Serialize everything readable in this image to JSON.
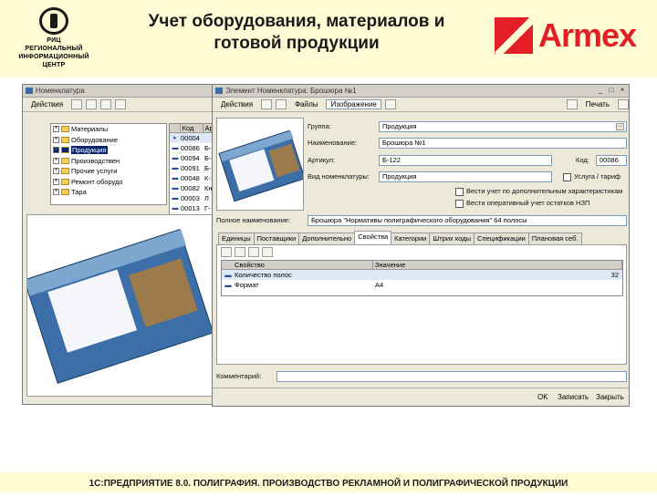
{
  "slide": {
    "logo_lines": [
      "РИЦ",
      "РЕГИОНАЛЬНЫЙ",
      "ИНФОРМАЦИОННЫЙ",
      "ЦЕНТР"
    ],
    "title_line1": "Учет оборудования, материалов и",
    "title_line2": "готовой продукции",
    "brand": "Armex",
    "footer": "1С:ПРЕДПРИЯТИЕ 8.0. ПОЛИГРАФИЯ. ПРОИЗВОДСТВО РЕКЛАМНОЙ И ПОЛИГРАФИЧЕСКОЙ ПРОДУКЦИИ"
  },
  "nomenclature_window": {
    "title": "Номенклатура",
    "actions_menu": "Действия",
    "tree": [
      {
        "label": "Материалы",
        "expander": "+"
      },
      {
        "label": "Оборудование",
        "expander": "+"
      },
      {
        "label": "Продукция",
        "expander": "-",
        "selected": true
      },
      {
        "label": "Производствен",
        "expander": "+"
      },
      {
        "label": "Прочие услуги",
        "expander": "+"
      },
      {
        "label": "Ремонт оборудо",
        "expander": "+"
      },
      {
        "label": "Тара",
        "expander": "+"
      }
    ],
    "grid_columns": [
      "Код",
      "Арт"
    ],
    "grid_rows": [
      {
        "code": "00004",
        "art": "",
        "selected": true
      },
      {
        "code": "00086",
        "art": "Б-1"
      },
      {
        "code": "00094",
        "art": "Б-4"
      },
      {
        "code": "00091",
        "art": "Б-1"
      },
      {
        "code": "00048",
        "art": "К-1"
      },
      {
        "code": "00082",
        "art": "Кн"
      },
      {
        "code": "00003",
        "art": "Л"
      },
      {
        "code": "00013",
        "art": "Г-"
      },
      {
        "code": "00093",
        "art": "Г-"
      }
    ]
  },
  "element_window": {
    "title": "Элемент Номенклатура: Брошюра №1",
    "menu": [
      "Действия",
      "Файлы",
      "Изображение"
    ],
    "print_menu": "Печать",
    "fields": {
      "group_label": "Группа:",
      "group_value": "Продукция",
      "name_label": "Наименование:",
      "name_value": "Брошюра №1",
      "article_label": "Артикул:",
      "article_value": "Б-122",
      "code_label": "Код:",
      "code_value": "00086",
      "type_label": "Вид номенклатуры:",
      "type_value": "Продукция",
      "check_service": "Услуга / тариф",
      "check_characteristics": "Вести учет по дополнительным характеристикам",
      "check_wip": "Вести оперативный учет остатков НЗП",
      "fullname_label": "Полное наименование:",
      "fullname_value": "Брошюра \"Нормативы полиграфического оборудования\" 64 полосы",
      "comment_label": "Комментарий:"
    },
    "tabs": [
      "Единицы",
      "Поставщики",
      "Дополнительно",
      "Свойства",
      "Категории",
      "Штрих коды",
      "Спецификации",
      "Плановая себ."
    ],
    "active_tab": "Свойства",
    "props_columns": [
      "Свойство",
      "Значение"
    ],
    "props_rows": [
      {
        "name": "Количество полос",
        "value": "32"
      },
      {
        "name": "Формат",
        "value": "А4"
      }
    ],
    "ok": "OK",
    "write": "Записать",
    "close": "Закрыть"
  }
}
